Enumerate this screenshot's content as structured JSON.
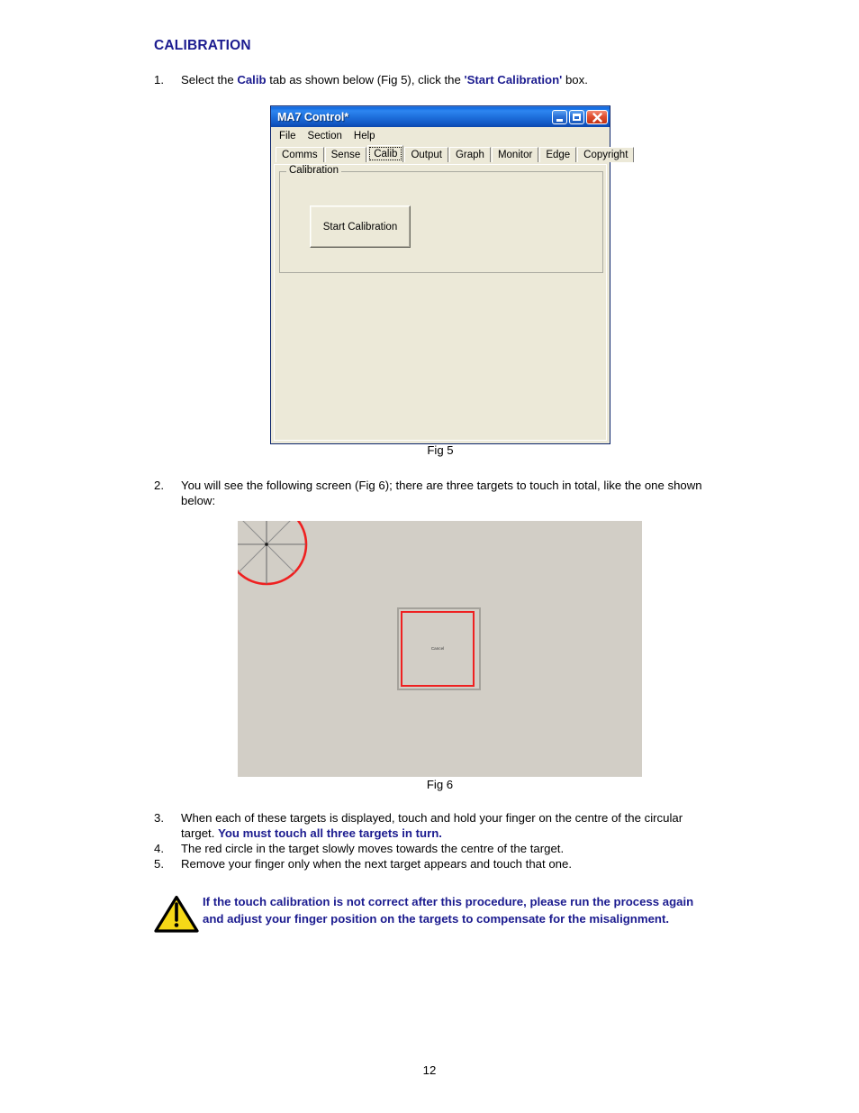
{
  "document": {
    "section_title": "CALIBRATION",
    "page_number": "12"
  },
  "steps": [
    {
      "num": "1.",
      "parts": [
        {
          "text": "Select the ",
          "style": "normal"
        },
        {
          "text": "Calib",
          "style": "bold-blue"
        },
        {
          "text": " tab as shown below (Fig 5), click the ",
          "style": "normal"
        },
        {
          "text": "'Start Calibration'",
          "style": "bold-blue"
        },
        {
          "text": " box.",
          "style": "normal"
        }
      ]
    },
    {
      "num": "2.",
      "parts": [
        {
          "text": "You will see the following screen (Fig 6); there are three targets to touch in total, like the one shown below:",
          "style": "normal"
        }
      ]
    },
    {
      "num": "3.",
      "parts": [
        {
          "text": "When each of these targets is displayed, touch and hold your finger on the centre of the circular target. ",
          "style": "normal"
        },
        {
          "text": "You must touch all three targets in turn.",
          "style": "bold-blue"
        }
      ]
    },
    {
      "num": "4.",
      "parts": [
        {
          "text": "The red circle in the target slowly moves towards the centre of the target.",
          "style": "normal"
        }
      ]
    },
    {
      "num": "5.",
      "parts": [
        {
          "text": "Remove your finger only when the next target appears and touch that one.",
          "style": "normal"
        }
      ]
    }
  ],
  "ma7_window": {
    "title": "MA7 Control*",
    "window_buttons": [
      {
        "name": "minimize",
        "label": "_"
      },
      {
        "name": "maximize",
        "label": "□"
      },
      {
        "name": "close",
        "label": "✕"
      }
    ],
    "menu": [
      "File",
      "Section",
      "Help"
    ],
    "tabs": [
      {
        "label": "Comms",
        "selected": false
      },
      {
        "label": "Sense",
        "selected": false
      },
      {
        "label": "Calib",
        "selected": true
      },
      {
        "label": "Output",
        "selected": false
      },
      {
        "label": "Graph",
        "selected": false
      },
      {
        "label": "Monitor",
        "selected": false
      },
      {
        "label": "Edge",
        "selected": false
      },
      {
        "label": "Copyright",
        "selected": false
      }
    ],
    "groupbox_title": "Calibration",
    "start_button_label": "Start Calibration"
  },
  "figures": [
    {
      "caption": "Fig 5"
    },
    {
      "caption": "Fig 6"
    }
  ],
  "calibration_screen": {
    "cancel_label": "Cancel",
    "target_ring_color": "#ef2020",
    "spoke_color": "#6e6e6e",
    "background_color": "#d2cec6"
  },
  "warning": {
    "icon": "warning-triangle-icon",
    "text": "If the touch calibration is not correct after this procedure, please run the process again and adjust your finger position on the targets to compensate for the misalignment.",
    "color": "#1b1b8f"
  },
  "colors": {
    "heading_blue": "#1b1b8f",
    "titlebar_blue": "#1b6fdc",
    "window_face": "#ece9d8",
    "warning_yellow": "#f5d817"
  }
}
